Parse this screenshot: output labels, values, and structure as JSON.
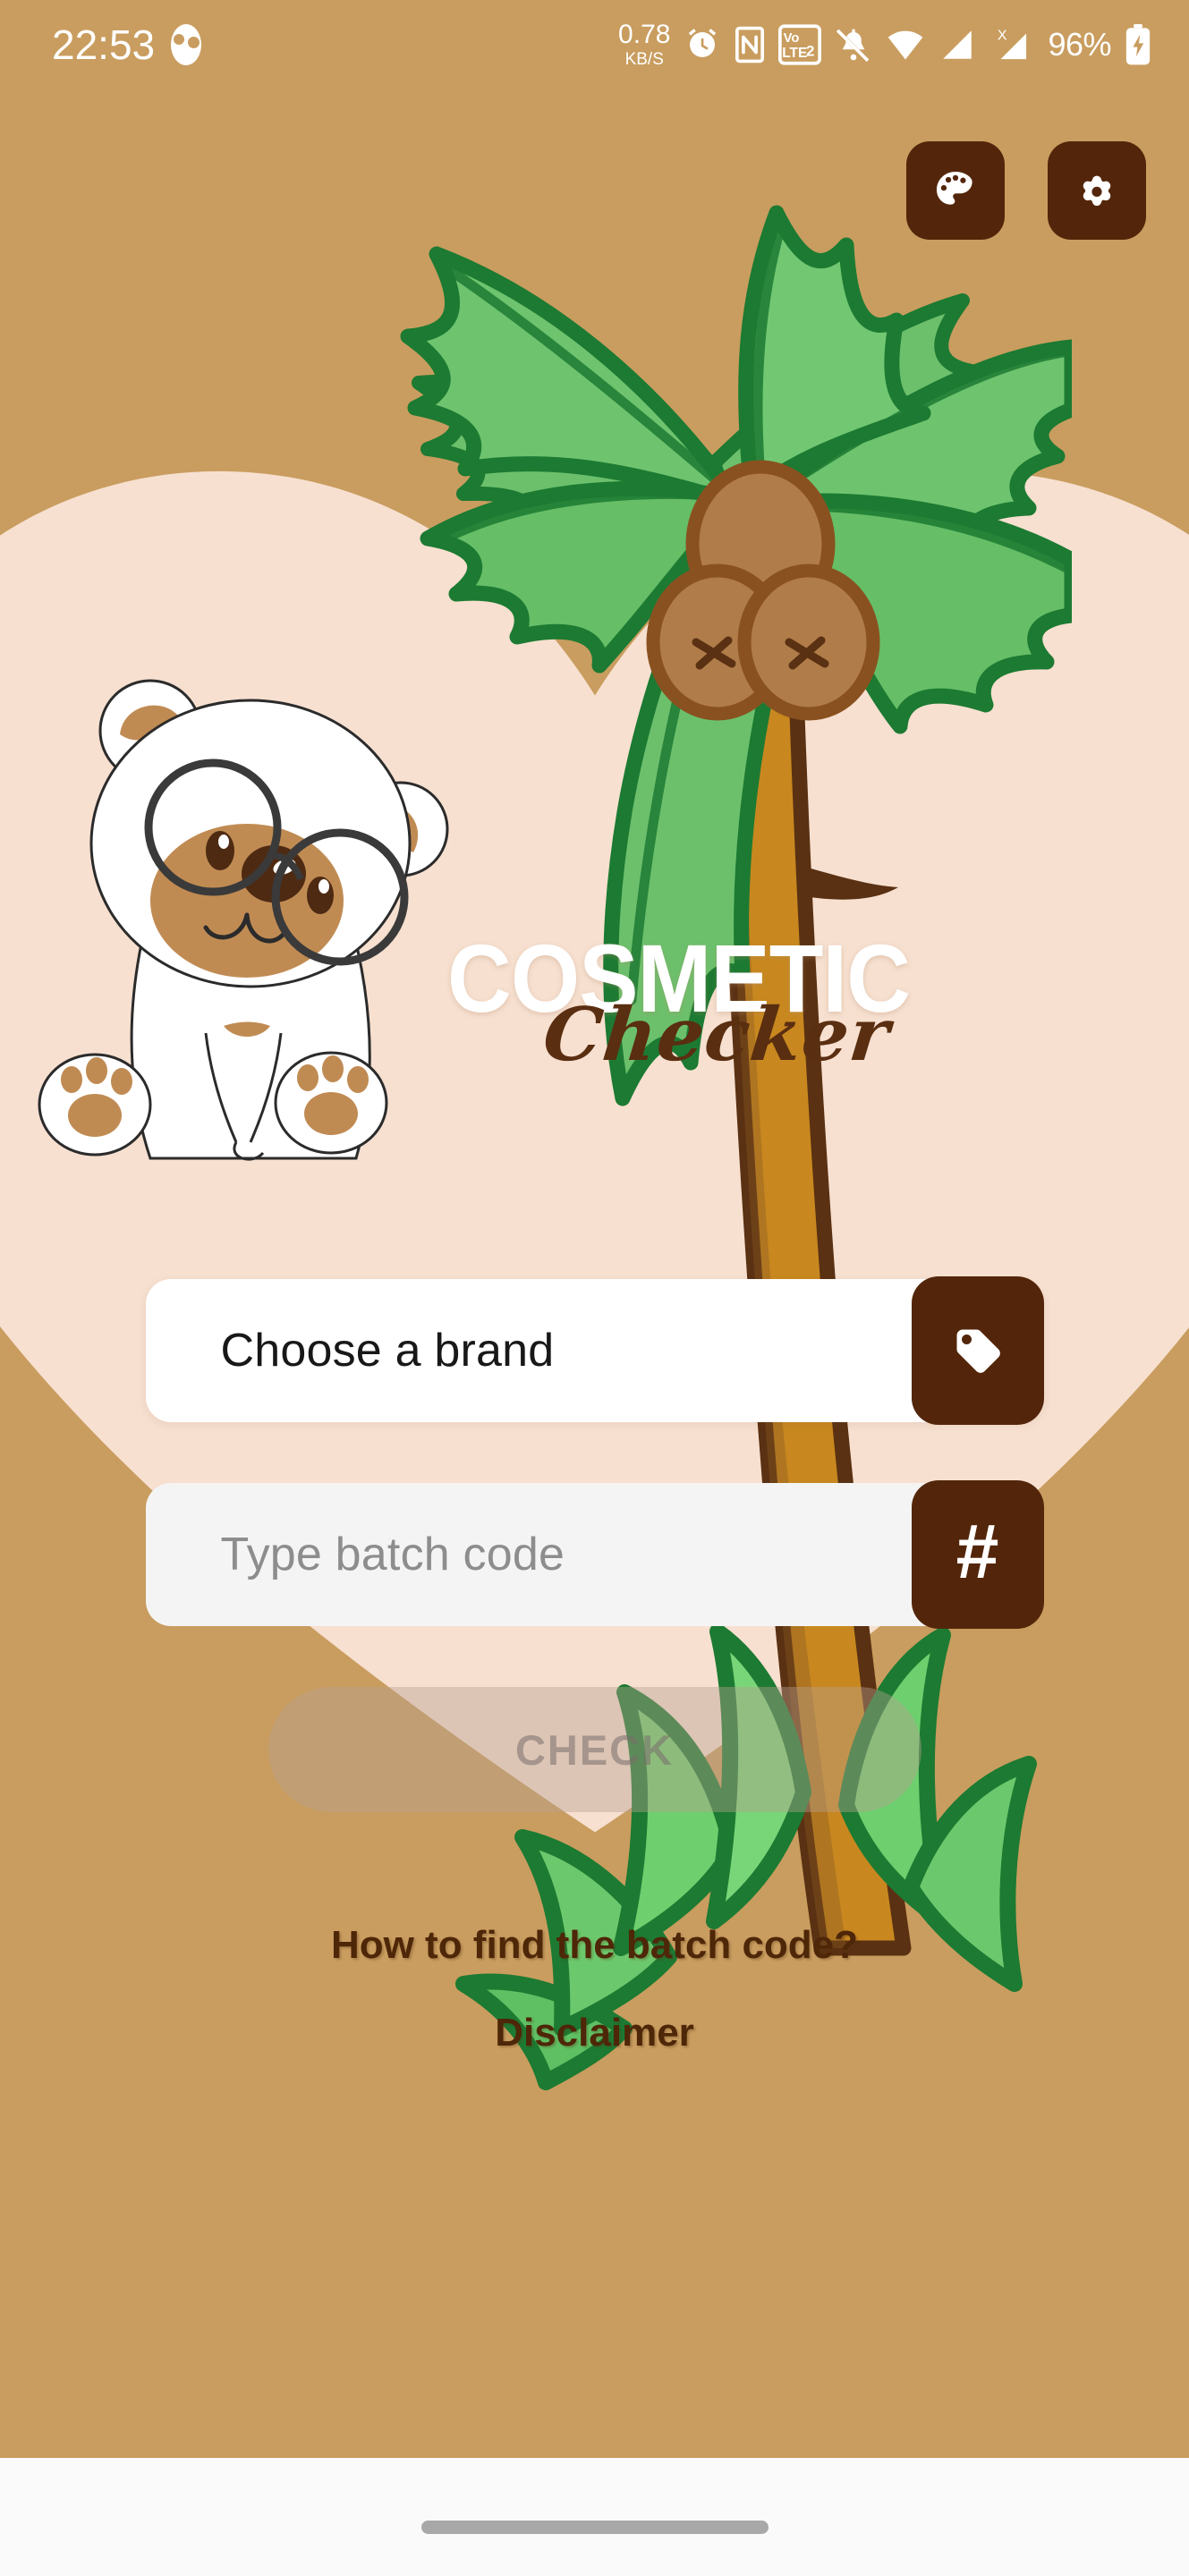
{
  "statusbar": {
    "time": "22:53",
    "app_icon": "app-notification-icon",
    "net_speed_value": "0.78",
    "net_speed_unit": "KB/S",
    "icons": [
      "alarm-icon",
      "nfc-icon",
      "volte2-icon",
      "mute-bell-icon",
      "wifi-icon",
      "signal-bars-icon",
      "signal-x-icon"
    ],
    "battery_percent": "96%",
    "battery_icon": "battery-charging-icon"
  },
  "topbar": {
    "theme_button_icon": "palette-icon",
    "theme_button_label": "Theme",
    "settings_button_icon": "gear-icon",
    "settings_button_label": "Settings"
  },
  "branding": {
    "title_main": "COSMETIC",
    "title_script": "Checker",
    "mascot": "teddy-bear-with-glasses",
    "decor_palm": "palm-tree",
    "decor_heart": "heart-backdrop"
  },
  "form": {
    "brand_field_value": "Choose a brand",
    "brand_button_icon": "price-tag-icon",
    "batch_field_placeholder": "Type batch code",
    "batch_field_value": "",
    "batch_button_icon": "hash-icon",
    "batch_button_label": "#",
    "check_button_label": "CHECK",
    "check_button_enabled": false
  },
  "links": {
    "how_to_find": "How to find the batch code?",
    "disclaimer": "Disclaimer"
  },
  "navbar": {
    "gesture_pill": "home-gesture-pill"
  },
  "colors": {
    "background": "#c99d5f",
    "heart": "#f7e0d0",
    "accent_dark_brown": "#53260b",
    "field_white": "#ffffff",
    "field_grey": "#f4f4f4",
    "link_text": "#4e2608",
    "leaf_green": "#6cc06c",
    "leaf_outline": "#1c7a32",
    "trunk_brown": "#c8881f",
    "trunk_outline": "#5a3112"
  }
}
